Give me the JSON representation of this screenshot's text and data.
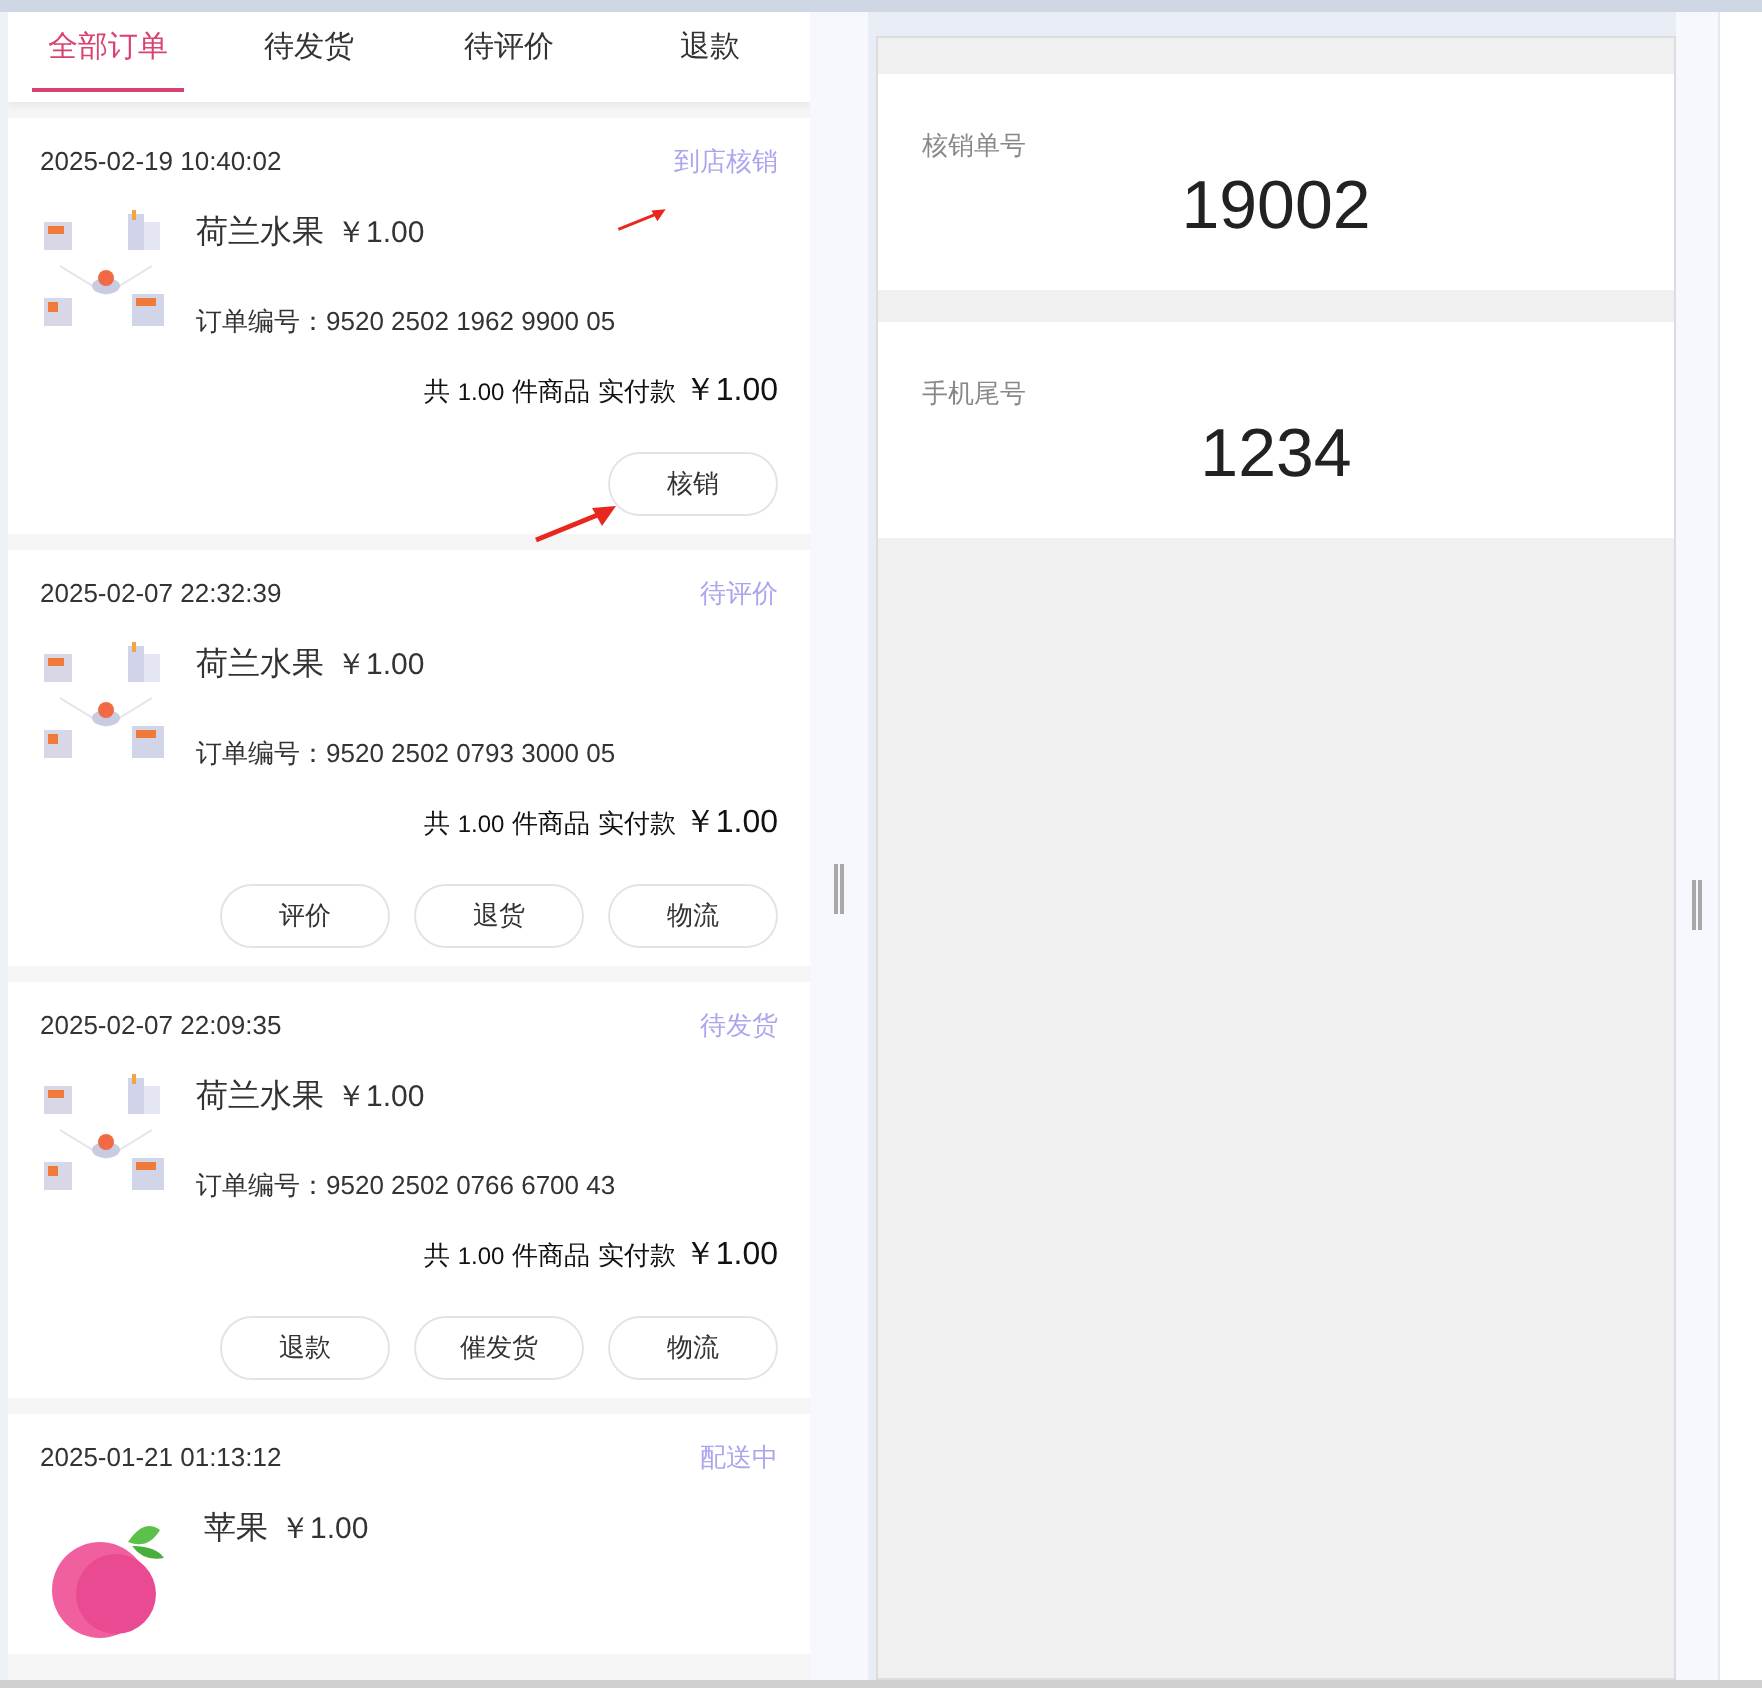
{
  "tabs": [
    {
      "label": "全部订单",
      "selected": true
    },
    {
      "label": "待发货",
      "selected": false
    },
    {
      "label": "待评价",
      "selected": false
    },
    {
      "label": "退款",
      "selected": false
    }
  ],
  "orders": [
    {
      "time": "2025-02-19 10:40:02",
      "status": "到店核销",
      "name": "荷兰水果",
      "price": "￥1.00",
      "order_no": "订单编号：9520 2502 1962 9900 05",
      "total_prefix": "共",
      "count": "1.00",
      "total_mid": "件商品 实付款",
      "total": "￥1.00",
      "buttons": [
        "核销"
      ]
    },
    {
      "time": "2025-02-07 22:32:39",
      "status": "待评价",
      "name": "荷兰水果",
      "price": "￥1.00",
      "order_no": "订单编号：9520 2502 0793 3000 05",
      "total_prefix": "共",
      "count": "1.00",
      "total_mid": "件商品 实付款",
      "total": "￥1.00",
      "buttons": [
        "评价",
        "退货",
        "物流"
      ]
    },
    {
      "time": "2025-02-07 22:09:35",
      "status": "待发货",
      "name": "荷兰水果",
      "price": "￥1.00",
      "order_no": "订单编号：9520 2502 0766 6700 43",
      "total_prefix": "共",
      "count": "1.00",
      "total_mid": "件商品 实付款",
      "total": "￥1.00",
      "buttons": [
        "退款",
        "催发货",
        "物流"
      ]
    },
    {
      "time": "2025-01-21 01:13:12",
      "status": "配送中",
      "name": "苹果",
      "price": "￥1.00"
    }
  ],
  "verify": [
    {
      "label": "核销单号",
      "value": "19002"
    },
    {
      "label": "手机尾号",
      "value": "1234"
    }
  ]
}
